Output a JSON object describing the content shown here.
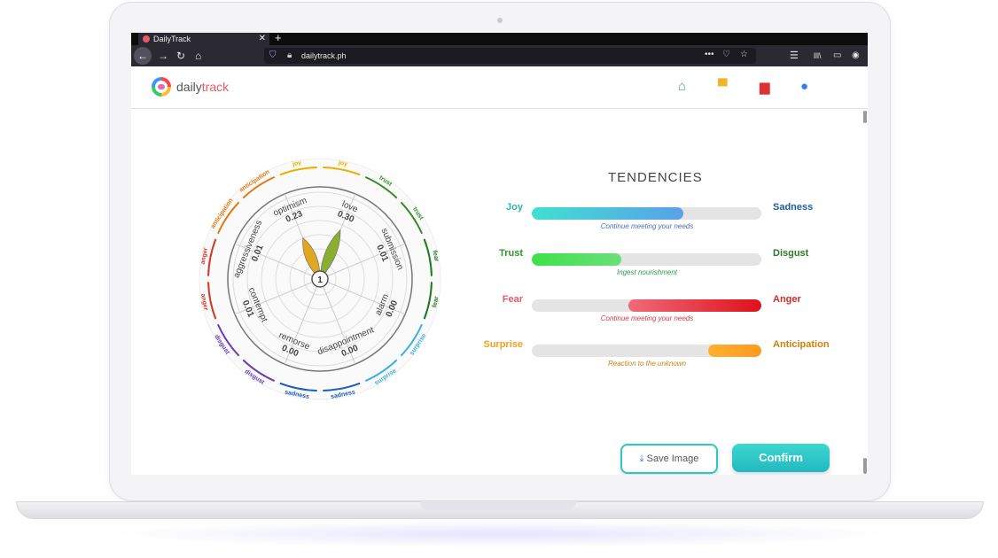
{
  "browser": {
    "tab_title": "DailyTrack",
    "tab_close": "✕",
    "new_tab": "+",
    "url": "dailytrack.ph",
    "nav_back": "←",
    "nav_forward": "→",
    "nav_reload": "↻",
    "nav_home": "⌂",
    "url_more": "•••",
    "url_pocket": "♡",
    "url_star": "☆",
    "menu_icon": "☰",
    "library_icon": "lll\\",
    "sidebar_icon": "▭",
    "account_icon": "◉"
  },
  "app": {
    "brand_prefix": "daily",
    "brand_suffix": "track",
    "nav_icons": [
      {
        "name": "home-icon",
        "glyph": "⌂",
        "color": "#3cb371"
      },
      {
        "name": "chat-icon",
        "glyph": "▀",
        "color": "#f0b429"
      },
      {
        "name": "book-icon",
        "glyph": "▆",
        "color": "#e03131"
      },
      {
        "name": "user-icon",
        "glyph": "●",
        "color": "#2f80ed"
      }
    ]
  },
  "wheel": {
    "center_value": "1",
    "dyads": [
      {
        "label": "love",
        "value": "0.30"
      },
      {
        "label": "submission",
        "value": "0.01"
      },
      {
        "label": "alarm",
        "value": "0.00"
      },
      {
        "label": "disappointment",
        "value": "0.00"
      },
      {
        "label": "remorse",
        "value": "0.00"
      },
      {
        "label": "contempt",
        "value": "0.01"
      },
      {
        "label": "aggressiveness",
        "value": "0.01"
      },
      {
        "label": "optimism",
        "value": "0.23"
      }
    ],
    "ring_labels": [
      {
        "text": "joy",
        "color": "#e8b000"
      },
      {
        "text": "trust",
        "color": "#3a8a2a"
      },
      {
        "text": "trust",
        "color": "#3a8a2a"
      },
      {
        "text": "fear",
        "color": "#1f7a1f"
      },
      {
        "text": "fear",
        "color": "#1f7a1f"
      },
      {
        "text": "surprise",
        "color": "#3ab0e0"
      },
      {
        "text": "surprise",
        "color": "#3ab0e0"
      },
      {
        "text": "sadness",
        "color": "#1f5fb0"
      },
      {
        "text": "sadness",
        "color": "#1f5fb0"
      },
      {
        "text": "disgust",
        "color": "#6a3ab0"
      },
      {
        "text": "disgust",
        "color": "#6a3ab0"
      },
      {
        "text": "anger",
        "color": "#d03a2a"
      },
      {
        "text": "anger",
        "color": "#d03a2a"
      },
      {
        "text": "anticipation",
        "color": "#e07a10"
      },
      {
        "text": "anticipation",
        "color": "#e07a10"
      },
      {
        "text": "joy",
        "color": "#e8b000"
      }
    ]
  },
  "tendencies": {
    "title": "TENDENCIES",
    "rows": [
      {
        "left": "Joy",
        "right": "Sadness",
        "caption": "Continue meeting your needs",
        "left_color": "#2ab3b0",
        "right_color": "#1f5fa0",
        "caption_color": "#4a6fb0",
        "fill_start": 0.0,
        "fill_end": 0.66,
        "grad": "linear-gradient(90deg,#3fe0d0,#5aa0ea)"
      },
      {
        "left": "Trust",
        "right": "Disgust",
        "caption": "Ingest nourishment",
        "left_color": "#2a9a2a",
        "right_color": "#2a7a2a",
        "caption_color": "#2a9a4a",
        "fill_start": 0.0,
        "fill_end": 0.39,
        "grad": "linear-gradient(90deg,#3ee04a,#6ae07a)"
      },
      {
        "left": "Fear",
        "right": "Anger",
        "caption": "Continue meeting your needs",
        "left_color": "#e85a6b",
        "right_color": "#d02a2a",
        "caption_color": "#d03a4a",
        "fill_start": 0.42,
        "fill_end": 1.0,
        "grad": "linear-gradient(90deg,#f06a7a,#e0101a)"
      },
      {
        "left": "Surprise",
        "right": "Anticipation",
        "caption": "Reaction to the unknown",
        "left_color": "#f0a020",
        "right_color": "#d08010",
        "caption_color": "#d08010",
        "fill_start": 0.77,
        "fill_end": 1.0,
        "grad": "linear-gradient(90deg,#ffb030,#ff9a20)"
      }
    ]
  },
  "actions": {
    "save_label": "Save Image",
    "save_icon": "⤓",
    "confirm_label": "Confirm"
  }
}
